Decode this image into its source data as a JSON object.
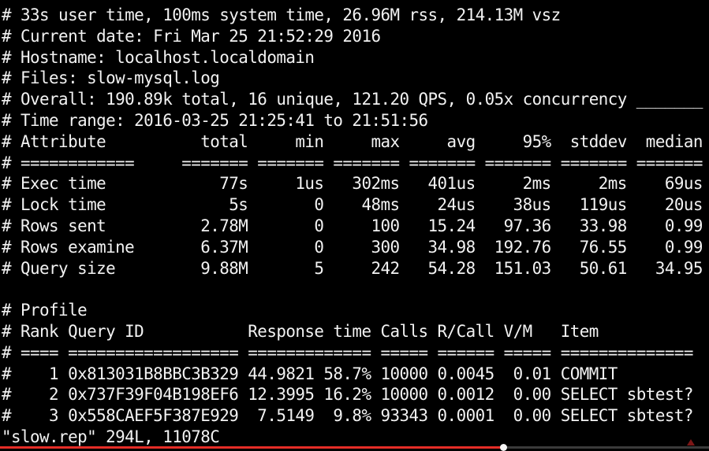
{
  "terminal": {
    "lines": [
      "# 33s user time, 100ms system time, 26.96M rss, 214.13M vsz",
      "# Current date: Fri Mar 25 21:52:29 2016",
      "# Hostname: localhost.localdomain",
      "# Files: slow-mysql.log",
      "# Overall: 190.89k total, 16 unique, 121.20 QPS, 0.05x concurrency _______",
      "# Time range: 2016-03-25 21:25:41 to 21:51:56",
      "# Attribute          total     min     max     avg     95%  stddev  median",
      "# ============     ======= ======= ======= ======= ======= ======= =======",
      "# Exec time            77s     1us   302ms   401us     2ms     2ms    69us",
      "# Lock time             5s       0    48ms    24us    38us   119us    20us",
      "# Rows sent          2.78M       0     100   15.24   97.36   33.98    0.99",
      "# Rows examine       6.37M       0     300   34.98  192.76   76.55    0.99",
      "# Query size         9.88M       5     242   54.28  151.03   50.61   34.95",
      "",
      "# Profile",
      "# Rank Query ID           Response time Calls R/Call V/M   Item",
      "# ==== ================== ============= ===== ====== ===== ==============",
      "#    1 0x813031B8BBC3B329 44.9821 58.7% 10000 0.0045  0.01 COMMIT",
      "#    2 0x737F39F04B198EF6 12.3995 16.2% 10000 0.0012  0.00 SELECT sbtest?",
      "#    3 0x558CAEF5F387E929  7.5149  9.8% 93343 0.0001  0.00 SELECT sbtest?",
      "\"slow.rep\" 294L, 11078C"
    ]
  },
  "player": {
    "progress_fraction": 0.71,
    "played_color": "#e52d27",
    "track_color": "#3a3a3a"
  }
}
